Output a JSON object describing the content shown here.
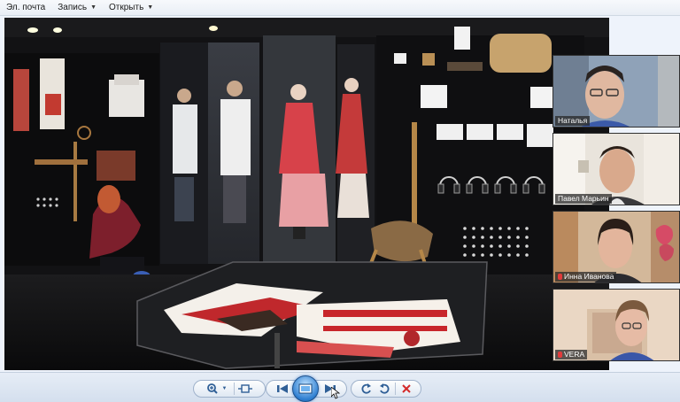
{
  "menubar": {
    "items": [
      {
        "label": "Эл. почта",
        "has_caret": false
      },
      {
        "label": "Запись",
        "has_caret": true
      },
      {
        "label": "Открыть",
        "has_caret": true
      }
    ]
  },
  "participants": [
    {
      "name": "Наталья",
      "mic_muted": false
    },
    {
      "name": "Павел Марьин",
      "mic_muted": false
    },
    {
      "name": "Инна Иванова",
      "mic_muted": true
    },
    {
      "name": "VERA",
      "mic_muted": true
    }
  ],
  "toolbar": {
    "icons": [
      "zoom-icon",
      "actual-size-icon",
      "previous-icon",
      "slideshow-icon",
      "next-icon",
      "rotate-left-icon",
      "rotate-right-icon",
      "delete-icon"
    ]
  },
  "colors": {
    "accent_blue": "#2f7fd1",
    "delete_red": "#d42a2a",
    "toolbar_blue": "#3a6ea5"
  }
}
